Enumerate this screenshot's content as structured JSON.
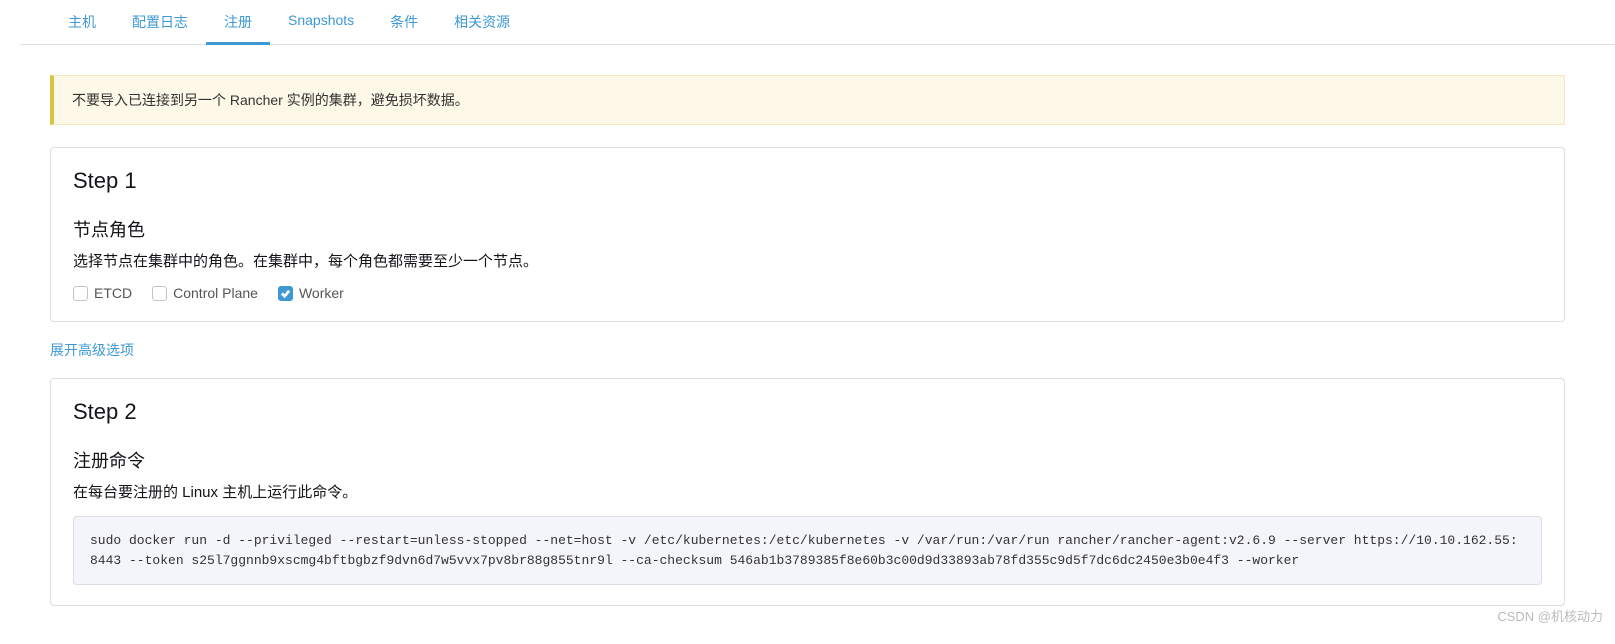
{
  "tabs": [
    {
      "label": "主机",
      "active": false
    },
    {
      "label": "配置日志",
      "active": false
    },
    {
      "label": "注册",
      "active": true
    },
    {
      "label": "Snapshots",
      "active": false
    },
    {
      "label": "条件",
      "active": false
    },
    {
      "label": "相关资源",
      "active": false
    }
  ],
  "alert": {
    "text": "不要导入已连接到另一个 Rancher 实例的集群，避免损坏数据。"
  },
  "step1": {
    "title": "Step 1",
    "section_title": "节点角色",
    "section_desc": "选择节点在集群中的角色。在集群中，每个角色都需要至少一个节点。",
    "roles": [
      {
        "label": "ETCD",
        "checked": false
      },
      {
        "label": "Control Plane",
        "checked": false
      },
      {
        "label": "Worker",
        "checked": true
      }
    ]
  },
  "advanced_link": "展开高级选项",
  "step2": {
    "title": "Step 2",
    "section_title": "注册命令",
    "section_desc": "在每台要注册的 Linux 主机上运行此命令。",
    "command": "sudo docker run -d --privileged --restart=unless-stopped --net=host -v /etc/kubernetes:/etc/kubernetes -v /var/run:/var/run rancher/rancher-agent:v2.6.9 --server https://10.10.162.55:8443 --token s25l7ggnnb9xscmg4bftbgbzf9dvn6d7w5vvx7pv8br88g855tnr9l --ca-checksum 546ab1b3789385f8e60b3c00d9d33893ab78fd355c9d5f7dc6dc2450e3b0e4f3 --worker"
  },
  "watermark": "CSDN @机核动力"
}
